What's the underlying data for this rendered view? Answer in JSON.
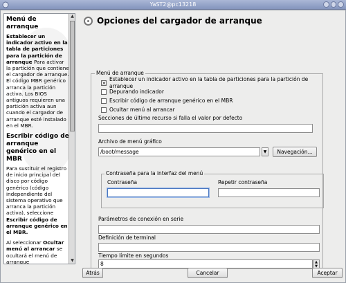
{
  "window": {
    "title": "YaST2@pc13218"
  },
  "help": {
    "sections": [
      {
        "heading": "Menú de arranque",
        "bold_intro": "Establecer un indicador activo en la tabla de particiones para la partición de arranque",
        "body": "Para activar la partición que contiene el cargador de arranque. El código MBR genérico arranca la partición activa. Los BIOS antiguos requieren una partición activa aun cuando el cargador de arranque esté instalado en el MBR."
      },
      {
        "heading": "Escribir código de arranque genérico en el MBR",
        "body_pre": "Para sustituir el registro de inicio principal del disco por código genérico (código independiente del sistema operativo que arranca la partición activa), seleccione",
        "body_bold": "Escribir código de arranque genérico en el MBR."
      },
      {
        "body_pre": "Al seleccionar",
        "body_bold": "Ocultar menú al arrancar",
        "body_post": "se ocultará el menú de arranque"
      }
    ]
  },
  "page": {
    "title": "Opciones del cargador de arranque",
    "boot_menu_legend": "Menú de arranque",
    "checkboxes": [
      {
        "label": "Establecer un indicador activo en la tabla de particiones para la partición de arranque",
        "checked": true
      },
      {
        "label": "Depurando indicador",
        "checked": false
      },
      {
        "label": "Escribir código de arranque genérico en el MBR",
        "checked": false
      },
      {
        "label": "Ocultar menú al arrancar",
        "checked": false
      }
    ],
    "fallback_label": "Secciones de último recurso si falla el valor por defecto",
    "fallback_value": "",
    "gfx_label": "Archivo de menú gráfico",
    "gfx_value": "/boot/message",
    "browse_button": "Navegación...",
    "password_legend": "Contraseña para la interfaz del menú",
    "password_label": "Contraseña",
    "password_repeat_label": "Repetir contraseña",
    "serial_label": "Parámetros de conexión en serie",
    "serial_value": "",
    "terminal_label": "Definición de terminal",
    "terminal_value": "",
    "timeout_label": "Tiempo límite en segundos",
    "timeout_value": "8"
  },
  "footer": {
    "back": "Atrás",
    "cancel": "Cancelar",
    "accept": "Aceptar"
  }
}
